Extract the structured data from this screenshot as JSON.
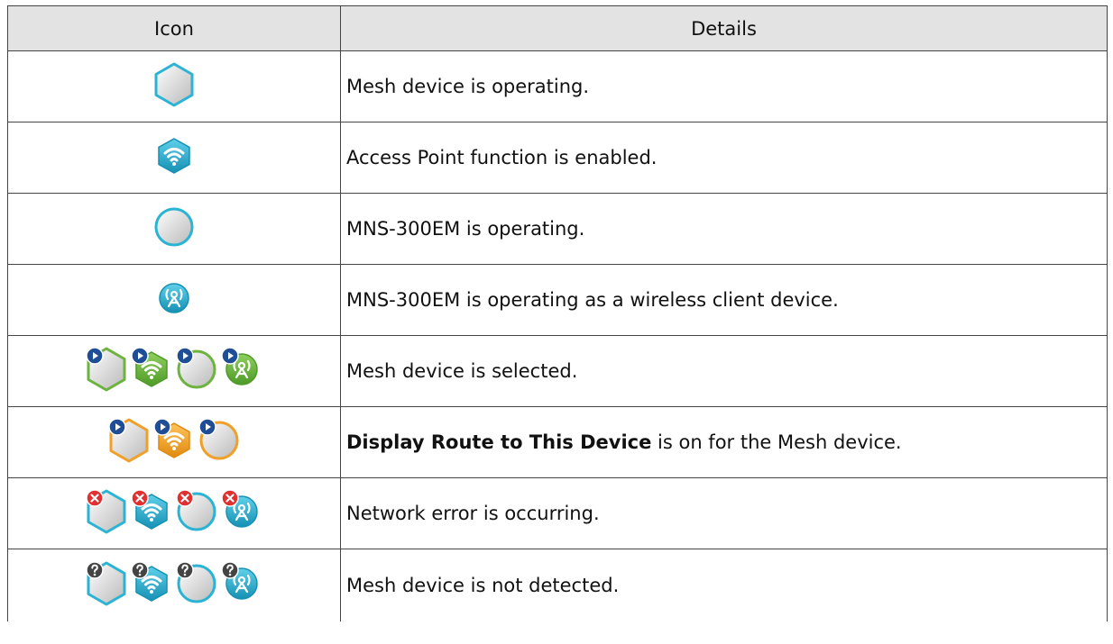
{
  "table": {
    "headers": {
      "icon": "Icon",
      "details": "Details"
    },
    "colors": {
      "teal": "#2bb3d4",
      "green": "#6db33f",
      "orange": "#f0a028",
      "header_bg": "#e3e3e3",
      "badge_blue": "#1f4e96",
      "badge_red": "#e03030",
      "badge_gray": "#444444"
    },
    "rows": [
      {
        "icons": [
          "hexagon-icon"
        ],
        "details": "Mesh device is operating."
      },
      {
        "icons": [
          "wifi-hexagon-icon"
        ],
        "details": "Access Point function is enabled."
      },
      {
        "icons": [
          "circle-icon"
        ],
        "details": "MNS-300EM is operating."
      },
      {
        "icons": [
          "antenna-circle-icon"
        ],
        "details": "MNS-300EM is operating as a wireless client device."
      },
      {
        "icons": [
          "hexagon-selected-icon",
          "wifi-hexagon-selected-icon",
          "circle-selected-icon",
          "antenna-circle-selected-icon"
        ],
        "details": "Mesh device is selected."
      },
      {
        "icons": [
          "hexagon-route-icon",
          "wifi-hexagon-route-icon",
          "circle-route-icon"
        ],
        "details_bold": "Display Route to This Device",
        "details_rest": " is on for the Mesh device."
      },
      {
        "icons": [
          "hexagon-error-icon",
          "wifi-hexagon-error-icon",
          "circle-error-icon",
          "antenna-circle-error-icon"
        ],
        "details": "Network error is occurring."
      },
      {
        "icons": [
          "hexagon-unknown-icon",
          "wifi-hexagon-unknown-icon",
          "circle-unknown-icon",
          "antenna-circle-unknown-icon"
        ],
        "details": "Mesh device is not detected."
      }
    ]
  }
}
